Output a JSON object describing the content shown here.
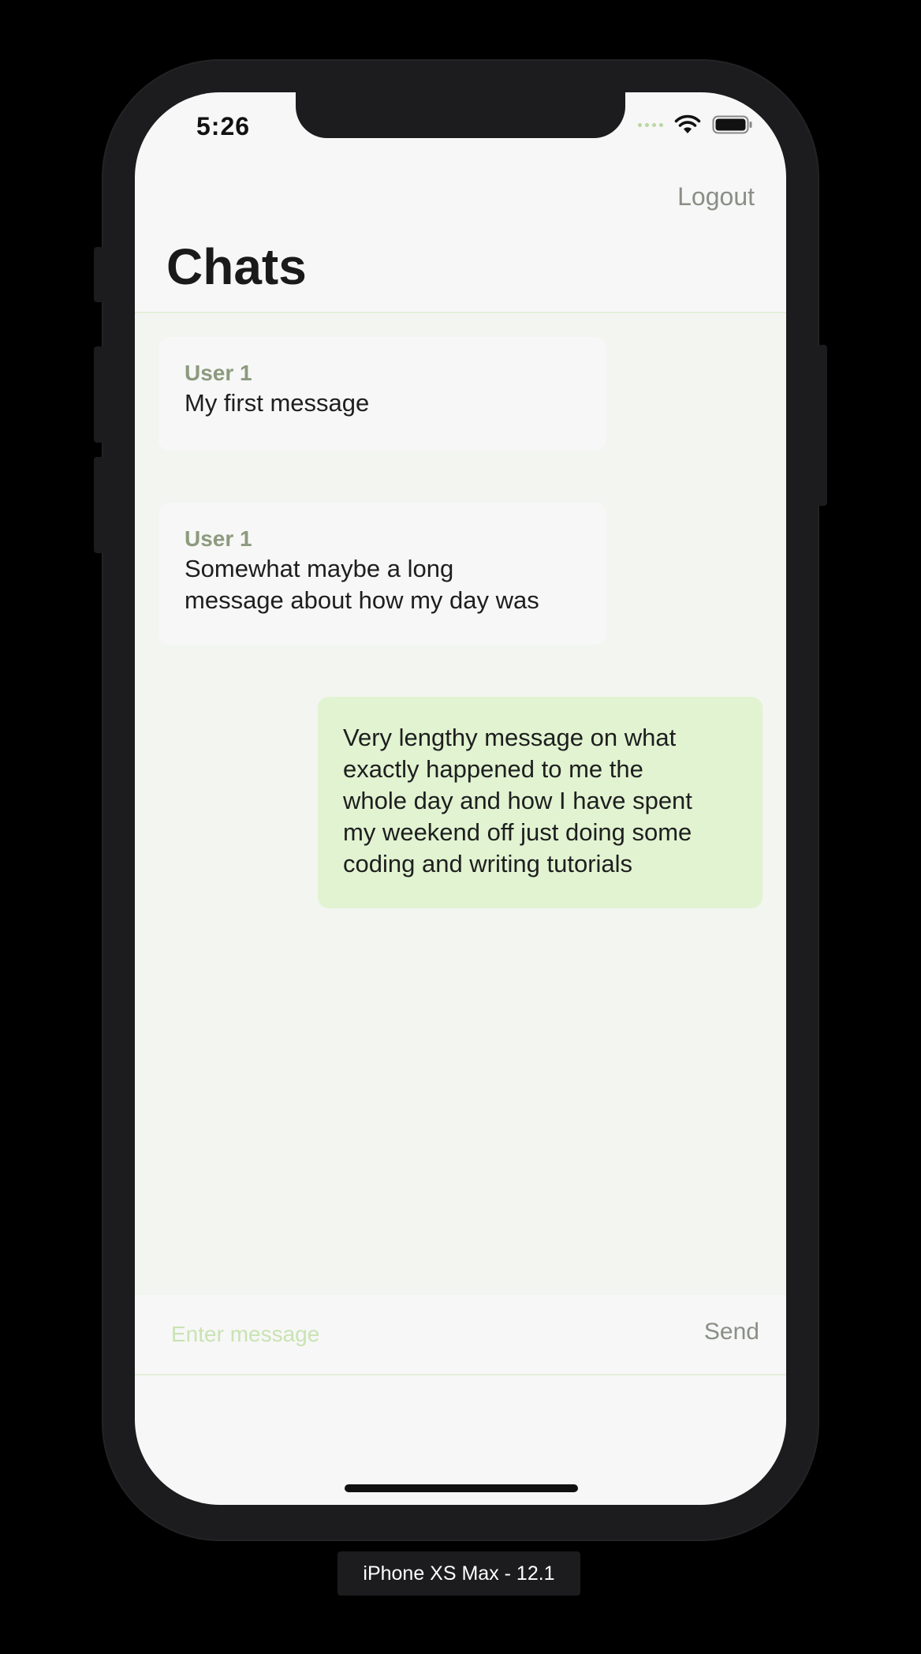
{
  "status_bar": {
    "time": "5:26",
    "icons": [
      "signal-icon",
      "wifi-icon",
      "battery-icon"
    ]
  },
  "navigation": {
    "logout_label": "Logout",
    "title": "Chats"
  },
  "messages": [
    {
      "direction": "incoming",
      "sender": "User 1",
      "lines": [
        "My first message"
      ]
    },
    {
      "direction": "incoming",
      "sender": "User 1",
      "lines": [
        "Somewhat maybe a long",
        "message about how my day was"
      ]
    },
    {
      "direction": "outgoing",
      "lines": [
        "Very lengthy message on what",
        "exactly happened to me the",
        "whole day and how I have spent",
        "my weekend off just doing some",
        "coding and writing tutorials"
      ]
    }
  ],
  "composer": {
    "placeholder": "Enter message",
    "value": "",
    "send_label": "Send"
  },
  "device_label": "iPhone XS Max - 12.1",
  "colors": {
    "accent": "#8a8f86",
    "sender": "#8c9a7e",
    "outgoing_bubble": "#e1f3d1",
    "incoming_bubble": "#f7f7f7",
    "placeholder": "#c9e3b2"
  }
}
